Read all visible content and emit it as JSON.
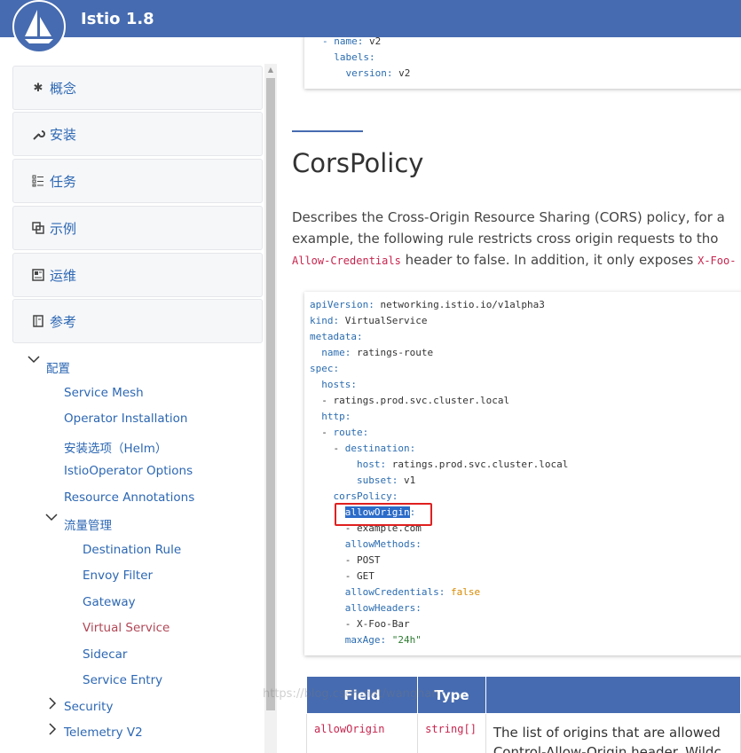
{
  "header": {
    "title": "Istio 1.8",
    "bg_color": "#466bb0"
  },
  "sidebar": {
    "sections": [
      {
        "label": "概念",
        "icon": "gear-icon"
      },
      {
        "label": "安装",
        "icon": "wrench-icon"
      },
      {
        "label": "任务",
        "icon": "list-icon"
      },
      {
        "label": "示例",
        "icon": "copy-icon"
      },
      {
        "label": "运维",
        "icon": "dashboard-icon"
      },
      {
        "label": "参考",
        "icon": "book-icon"
      }
    ],
    "tree": {
      "config_label": "配置",
      "config_items": [
        "Service Mesh",
        "Operator Installation",
        "安装选项（Helm）",
        "IstioOperator Options",
        "Resource Annotations"
      ],
      "traffic_label": "流量管理",
      "traffic_items": [
        "Destination Rule",
        "Envoy Filter",
        "Gateway",
        "Virtual Service",
        "Sidecar",
        "Service Entry"
      ],
      "active_item": "Virtual Service",
      "collapsed_items": [
        "Security",
        "Telemetry V2"
      ]
    }
  },
  "top_code": [
    "- name: v2",
    "  labels:",
    "    version: v2"
  ],
  "section": {
    "title": "CorsPolicy",
    "para_line1": "Describes the Cross-Origin Resource Sharing (CORS) policy, for a",
    "para_line2": "example, the following rule restricts cross origin requests to tho",
    "para_line3_code1": "Allow-Credentials",
    "para_line3_text": " header to false. In addition, it only exposes ",
    "para_line3_code2": "X-Foo-"
  },
  "code": [
    {
      "k": "apiVersion",
      "v": " networking.istio.io/v1alpha3",
      "indent": 0
    },
    {
      "k": "kind",
      "v": " VirtualService",
      "indent": 0
    },
    {
      "k": "metadata",
      "v": "",
      "indent": 0
    },
    {
      "k": "name",
      "v": " ratings-route",
      "indent": 2
    },
    {
      "k": "spec",
      "v": "",
      "indent": 0
    },
    {
      "k": "hosts",
      "v": "",
      "indent": 2
    },
    {
      "raw": "- ratings.prod.svc.cluster.local",
      "indent": 2
    },
    {
      "k": "http",
      "v": "",
      "indent": 2
    },
    {
      "dash": "- ",
      "k": "route",
      "v": "",
      "indent": 2
    },
    {
      "dash": "- ",
      "k": "destination",
      "v": "",
      "indent": 4
    },
    {
      "k": "host",
      "v": " ratings.prod.svc.cluster.local",
      "indent": 8
    },
    {
      "k": "subset",
      "v": " v1",
      "indent": 8
    },
    {
      "k": "corsPolicy",
      "v": "",
      "indent": 4
    },
    {
      "k": "allowOrigin",
      "v": "",
      "indent": 6,
      "selected": true
    },
    {
      "raw": "- example.com",
      "indent": 6
    },
    {
      "k": "allowMethods",
      "v": "",
      "indent": 6
    },
    {
      "raw": "- POST",
      "indent": 6
    },
    {
      "raw": "- GET",
      "indent": 6
    },
    {
      "k": "allowCredentials",
      "v": "false",
      "indent": 6,
      "vclass": "b"
    },
    {
      "k": "allowHeaders",
      "v": "",
      "indent": 6
    },
    {
      "raw": "- X-Foo-Bar",
      "indent": 6
    },
    {
      "k": "maxAge",
      "v": "\"24h\"",
      "indent": 6,
      "vclass": "s"
    }
  ],
  "table": {
    "headers": [
      "Field",
      "Type",
      ""
    ],
    "row": {
      "field": "allowOrigin",
      "type": "string[]",
      "desc1": "The list of origins that are allowed",
      "desc2": "Control-Allow-Origin header. Wildc"
    }
  },
  "watermark": "https://blog.csdn.net/wanghan"
}
